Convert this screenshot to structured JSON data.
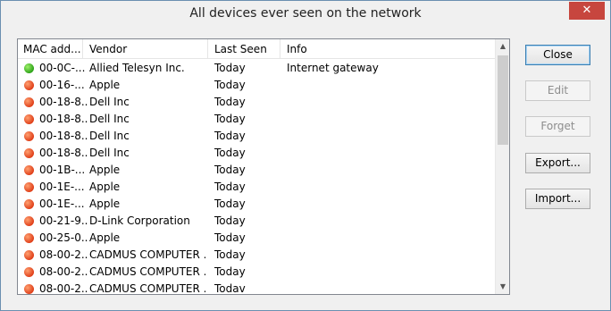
{
  "window": {
    "title": "All devices ever seen on the network",
    "close_glyph": "✕"
  },
  "columns": [
    "MAC add...",
    "Vendor",
    "Last Seen",
    "Info"
  ],
  "devices": [
    {
      "status": "green",
      "mac": "00-0C-...",
      "vendor": "Allied Telesyn Inc.",
      "last_seen": "Today",
      "info": "Internet gateway"
    },
    {
      "status": "red",
      "mac": "00-16-...",
      "vendor": "Apple",
      "last_seen": "Today",
      "info": ""
    },
    {
      "status": "red",
      "mac": "00-18-8...",
      "vendor": "Dell Inc",
      "last_seen": "Today",
      "info": ""
    },
    {
      "status": "red",
      "mac": "00-18-8...",
      "vendor": "Dell Inc",
      "last_seen": "Today",
      "info": ""
    },
    {
      "status": "red",
      "mac": "00-18-8...",
      "vendor": "Dell Inc",
      "last_seen": "Today",
      "info": ""
    },
    {
      "status": "red",
      "mac": "00-18-8...",
      "vendor": "Dell Inc",
      "last_seen": "Today",
      "info": ""
    },
    {
      "status": "red",
      "mac": "00-1B-...",
      "vendor": "Apple",
      "last_seen": "Today",
      "info": ""
    },
    {
      "status": "red",
      "mac": "00-1E-...",
      "vendor": "Apple",
      "last_seen": "Today",
      "info": ""
    },
    {
      "status": "red",
      "mac": "00-1E-...",
      "vendor": "Apple",
      "last_seen": "Today",
      "info": ""
    },
    {
      "status": "red",
      "mac": "00-21-9...",
      "vendor": "D-Link Corporation",
      "last_seen": "Today",
      "info": ""
    },
    {
      "status": "red",
      "mac": "00-25-0...",
      "vendor": "Apple",
      "last_seen": "Today",
      "info": ""
    },
    {
      "status": "red",
      "mac": "08-00-2...",
      "vendor": "CADMUS COMPUTER ...",
      "last_seen": "Today",
      "info": ""
    },
    {
      "status": "red",
      "mac": "08-00-2...",
      "vendor": "CADMUS COMPUTER ...",
      "last_seen": "Today",
      "info": ""
    },
    {
      "status": "red",
      "mac": "08-00-2...",
      "vendor": "CADMUS COMPUTER ...",
      "last_seen": "Todav",
      "info": ""
    }
  ],
  "buttons": {
    "close": "Close",
    "edit": "Edit",
    "forget": "Forget",
    "export": "Export...",
    "import": "Import..."
  },
  "scrollbar": {
    "up_glyph": "▲",
    "down_glyph": "▼"
  },
  "colors": {
    "online": "#2ea31a",
    "offline": "#e0401a"
  }
}
